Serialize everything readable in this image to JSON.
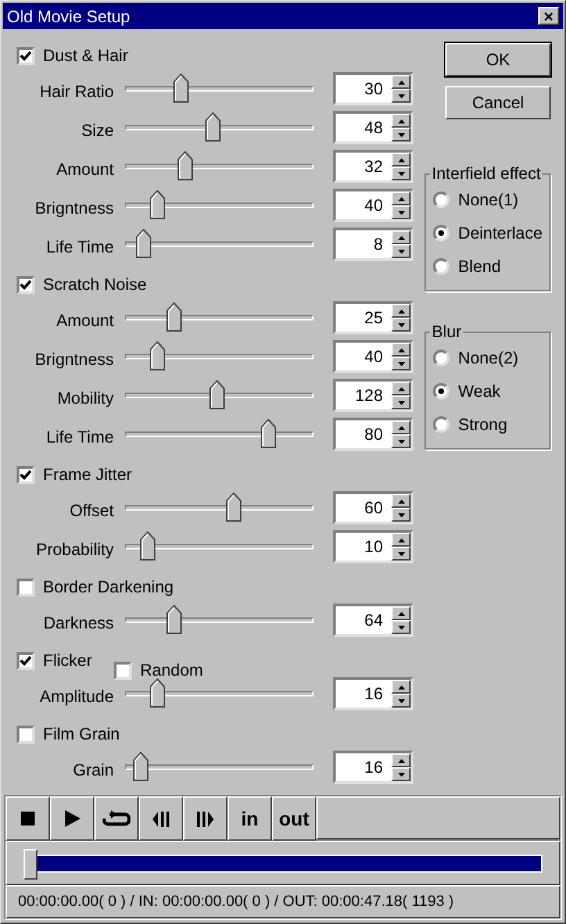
{
  "window": {
    "title": "Old Movie Setup",
    "close": "×"
  },
  "sections": [
    {
      "label": "Dust & Hair",
      "checked": true,
      "rows": [
        {
          "label": "Hair Ratio",
          "value": "30",
          "level": 0.28
        },
        {
          "label": "Size",
          "value": "48",
          "level": 0.46
        },
        {
          "label": "Amount",
          "value": "32",
          "level": 0.3
        },
        {
          "label": "Brigntness",
          "value": "40",
          "level": 0.14
        },
        {
          "label": "Life Time",
          "value": "8",
          "level": 0.06
        }
      ]
    },
    {
      "label": "Scratch Noise",
      "checked": true,
      "rows": [
        {
          "label": "Amount",
          "value": "25",
          "level": 0.24
        },
        {
          "label": "Brigntness",
          "value": "40",
          "level": 0.14
        },
        {
          "label": "Mobility",
          "value": "128",
          "level": 0.49
        },
        {
          "label": "Life Time",
          "value": "80",
          "level": 0.78
        }
      ]
    },
    {
      "label": "Frame Jitter",
      "checked": true,
      "rows": [
        {
          "label": "Offset",
          "value": "60",
          "level": 0.58
        },
        {
          "label": "Probability",
          "value": "10",
          "level": 0.09
        }
      ]
    },
    {
      "label": "Border Darkening",
      "checked": false,
      "rows": [
        {
          "label": "Darkness",
          "value": "64",
          "level": 0.24
        }
      ]
    },
    {
      "label": "Flicker",
      "checked": true,
      "extra": {
        "label": "Random",
        "checked": false
      },
      "rows": [
        {
          "label": "Amplitude",
          "value": "16",
          "level": 0.14
        }
      ]
    },
    {
      "label": "Film Grain",
      "checked": false,
      "rows": [
        {
          "label": "Grain",
          "value": "16",
          "level": 0.05
        }
      ]
    }
  ],
  "buttons": [
    {
      "label": "OK",
      "default": true
    },
    {
      "label": "Cancel",
      "default": false
    }
  ],
  "groups": [
    {
      "title": "Interfield effect",
      "options": [
        {
          "label": "None(1)",
          "selected": false
        },
        {
          "label": "Deinterlace",
          "selected": true
        },
        {
          "label": "Blend",
          "selected": false
        }
      ]
    },
    {
      "title": "Blur",
      "options": [
        {
          "label": "None(2)",
          "selected": false
        },
        {
          "label": "Weak",
          "selected": true
        },
        {
          "label": "Strong",
          "selected": false
        }
      ]
    }
  ],
  "transport": [
    {
      "kind": "stop"
    },
    {
      "kind": "play"
    },
    {
      "kind": "loop"
    },
    {
      "kind": "step-back"
    },
    {
      "kind": "step-forward"
    },
    {
      "kind": "text",
      "label": "in"
    },
    {
      "kind": "text",
      "label": "out"
    }
  ],
  "seek": {
    "level": 0
  },
  "status": "00:00:00.00( 0 ) / IN: 00:00:00.00( 0 ) / OUT: 00:00:47.18( 1193 )"
}
